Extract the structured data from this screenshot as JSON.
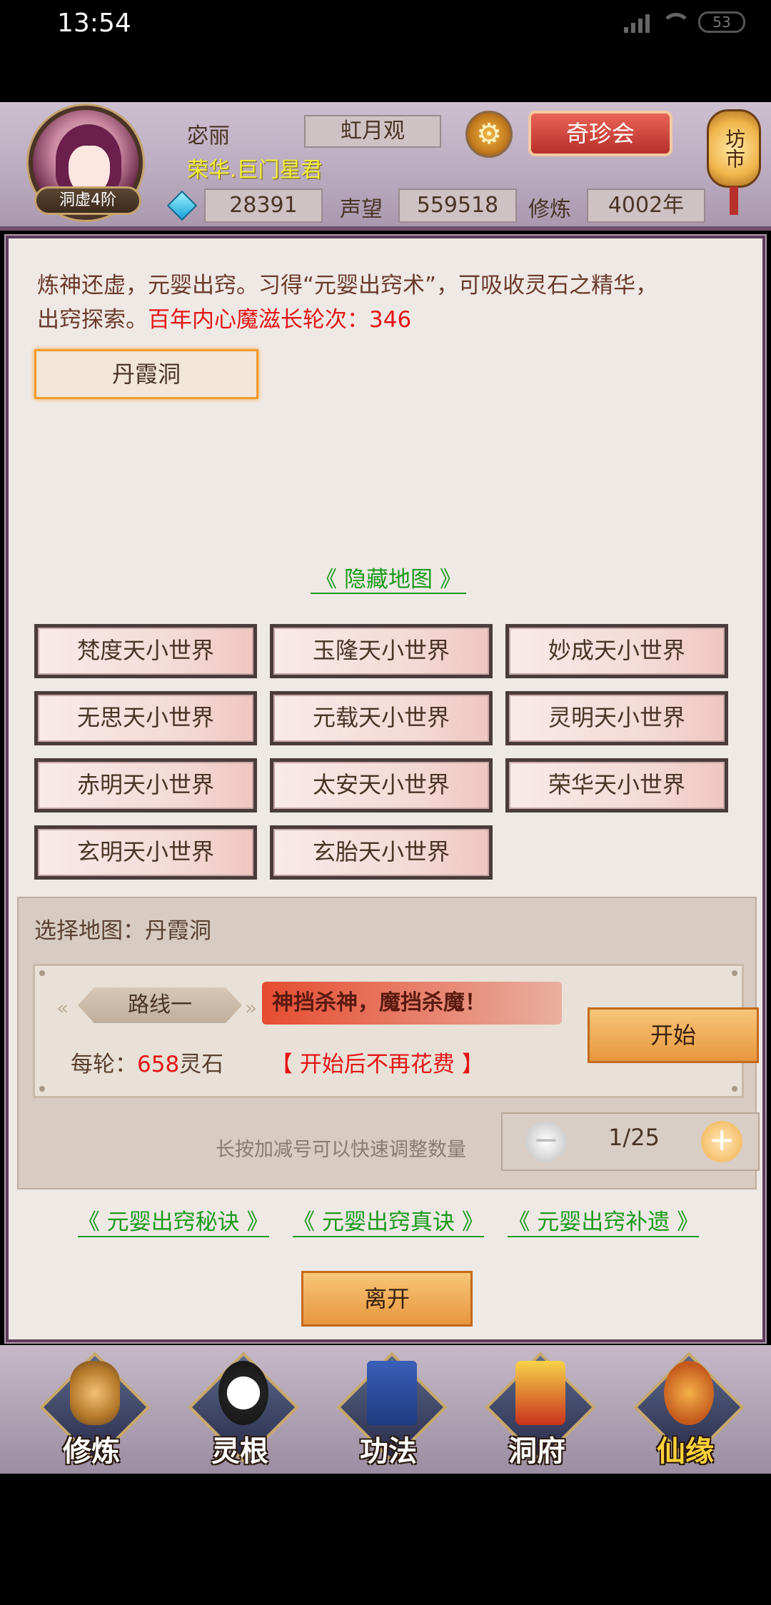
{
  "status_bar": {
    "time": "13:54",
    "battery": "53"
  },
  "header": {
    "avatar_badge": "洞虚4阶",
    "player_name": "宓丽",
    "player_title": "荣华.巨门星君",
    "sect": "虹月观",
    "qizhen_button": "奇珍会",
    "market_lantern": "坊市",
    "spirit_stones": "28391",
    "prestige_label": "声望",
    "prestige": "559518",
    "cultivation_label": "修炼",
    "cultivation": "4002年"
  },
  "main": {
    "intro_text": "炼神还虚，元婴出窍。习得“元婴出窍术”，可吸收灵石之精华，出窍探索。",
    "intro_red": "百年内心魔滋长轮次：346",
    "selected_cave_button": "丹霞洞",
    "hidden_map_link": "《 隐藏地图 》",
    "worlds": [
      "梵度天小世界",
      "玉隆天小世界",
      "妙成天小世界",
      "无思天小世界",
      "元载天小世界",
      "灵明天小世界",
      "赤明天小世界",
      "太安天小世界",
      "荣华天小世界",
      "玄明天小世界",
      "玄胎天小世界"
    ]
  },
  "selection": {
    "label": "选择地图：丹霞洞",
    "route_tag": "路线一",
    "slogan": "神挡杀神，魔挡杀魔！",
    "cost_prefix": "每轮：",
    "cost_value": "658",
    "cost_suffix": "灵石",
    "cost_note": "【 开始后不再花费 】",
    "start_button": "开始",
    "hint": "长按加减号可以快速调整数量",
    "stepper_value": "1/25",
    "minus": "−",
    "plus": "+"
  },
  "links": [
    "《 元婴出窍秘诀 》",
    "《 元婴出窍真诀 》",
    "《 元婴出窍补遗 》"
  ],
  "leave_button": "离开",
  "bottom_nav": [
    {
      "label": "修炼",
      "icon": "hooded-figure-icon"
    },
    {
      "label": "灵根",
      "icon": "yin-yang-sword-icon"
    },
    {
      "label": "功法",
      "icon": "book-icon"
    },
    {
      "label": "洞府",
      "icon": "pagoda-icon"
    },
    {
      "label": "仙缘",
      "icon": "gourd-icon"
    }
  ],
  "colors": {
    "accent_red": "#e51515",
    "link_green": "#1b9a1b",
    "title_yellow": "#f3f03a",
    "button_orange": "#e8963e"
  }
}
